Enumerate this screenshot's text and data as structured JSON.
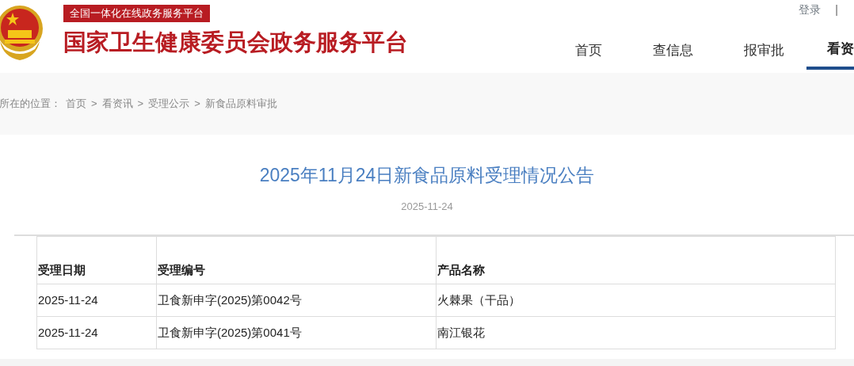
{
  "header": {
    "tag": "全国一体化在线政务服务平台",
    "site_title": "国家卫生健康委员会政务服务平台",
    "top_links": [
      {
        "label": "登录"
      }
    ],
    "top_separators": [
      "|"
    ],
    "nav": [
      {
        "label": "首页",
        "selected": false
      },
      {
        "label": "查信息",
        "selected": false
      },
      {
        "label": "报审批",
        "selected": false
      },
      {
        "label": "看资",
        "selected": true
      }
    ]
  },
  "breadcrumb": {
    "prefix": "所在的位置：",
    "items": [
      "首页",
      "看资讯",
      "受理公示",
      "新食品原料审批"
    ],
    "separators": [
      ">",
      ">",
      ">"
    ]
  },
  "article": {
    "title": "2025年11月24日新食品原料受理情况公告",
    "date": "2025-11-24"
  },
  "table": {
    "columns": [
      "受理日期",
      "受理编号",
      "产品名称"
    ],
    "rows": [
      [
        "2025-11-24",
        "卫食新申字(2025)第0042号",
        "火棘果（干品）"
      ],
      [
        "2025-11-24",
        "卫食新申字(2025)第0041号",
        "南江银花"
      ]
    ]
  }
}
